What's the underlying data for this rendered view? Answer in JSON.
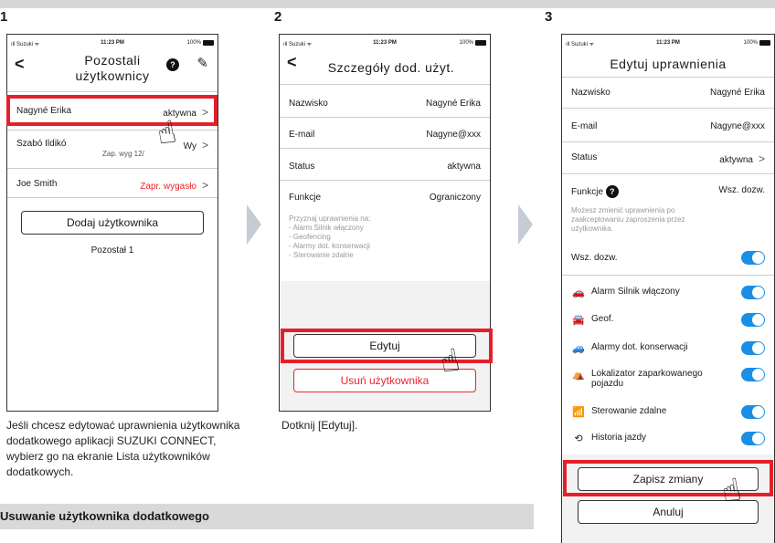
{
  "steps": [
    "1",
    "2",
    "3"
  ],
  "status_bar": {
    "carrier": "ıll Suzuki ᯤ",
    "time": "11:23 PM",
    "battery": "100%"
  },
  "phone1": {
    "title_line1": "Pozostali",
    "title_line2": "użytkownicy",
    "users": [
      {
        "name": "Nagyné Erika",
        "status": "aktywna",
        "sub": ""
      },
      {
        "name": "Szabó Ildikó",
        "status": "Wy",
        "sub": "Zap. wyg 12/"
      },
      {
        "name": "Joe Smith",
        "status": "Zapr. wygasło",
        "sub": ""
      }
    ],
    "add_button": "Dodaj użytkownika",
    "remaining": "Pozostał 1"
  },
  "phone2": {
    "title": "Szczegóły dod. użyt.",
    "rows": [
      {
        "label": "Nazwisko",
        "value": "Nagyné Erika"
      },
      {
        "label": "E-mail",
        "value": "Nagyne@xxx"
      },
      {
        "label": "Status",
        "value": "aktywna"
      },
      {
        "label": "Funkcje",
        "value": "Ograniczony"
      }
    ],
    "perms_text": "Przyznaj uprawnienia na:\n- Alarm Silnik włączony\n- Geofencing\n- Alarmy dot. konserwacji\n- Sterowanie zdalne",
    "edit_button": "Edytuj",
    "delete_button": "Usuń użytkownika"
  },
  "phone3": {
    "title": "Edytuj uprawnienia",
    "rows": [
      {
        "label": "Nazwisko",
        "value": "Nagyné Erika"
      },
      {
        "label": "E-mail",
        "value": "Nagyne@xxx"
      },
      {
        "label": "Status",
        "value": "aktywna"
      }
    ],
    "functions_label": "Funkcje",
    "functions_value": "Wsz. dozw.",
    "note": "Możesz zmienić uprawnienia po zaakceptowaniu zaproszenia przez użytkownika.",
    "all_allowed": "Wsz. dozw.",
    "features": [
      {
        "icon": "car-alert-icon",
        "glyph": "🚗",
        "label": "Alarm Silnik włączony"
      },
      {
        "icon": "geofence-icon",
        "glyph": "🚘",
        "label": "Geof."
      },
      {
        "icon": "maintenance-icon",
        "glyph": "🚙",
        "label": "Alarmy dot. konserwacji"
      },
      {
        "icon": "parking-locator-icon",
        "glyph": "⛺",
        "label": "Lokalizator zaparkowanego pojazdu"
      },
      {
        "icon": "remote-control-icon",
        "glyph": "📶",
        "label": "Sterowanie zdalne"
      },
      {
        "icon": "history-icon",
        "glyph": "⟲",
        "label": "Historia jazdy"
      }
    ],
    "save_button": "Zapisz zmiany",
    "cancel_button": "Anuluj"
  },
  "captions": {
    "step1": "Jeśli chcesz edytować uprawnienia użytkownika dodatkowego aplikacji SUZUKI CONNECT, wybierz go na ekranie Lista użytkowników dodatkowych.",
    "step2": "Dotknij [Edytuj]."
  },
  "section_title": "Usuwanie użytkownika dodatkowego",
  "colors": {
    "highlight": "#e4202b",
    "toggle": "#1a8fe6",
    "accent_red": "#e8262e",
    "arrow": "#c6ccd6"
  }
}
